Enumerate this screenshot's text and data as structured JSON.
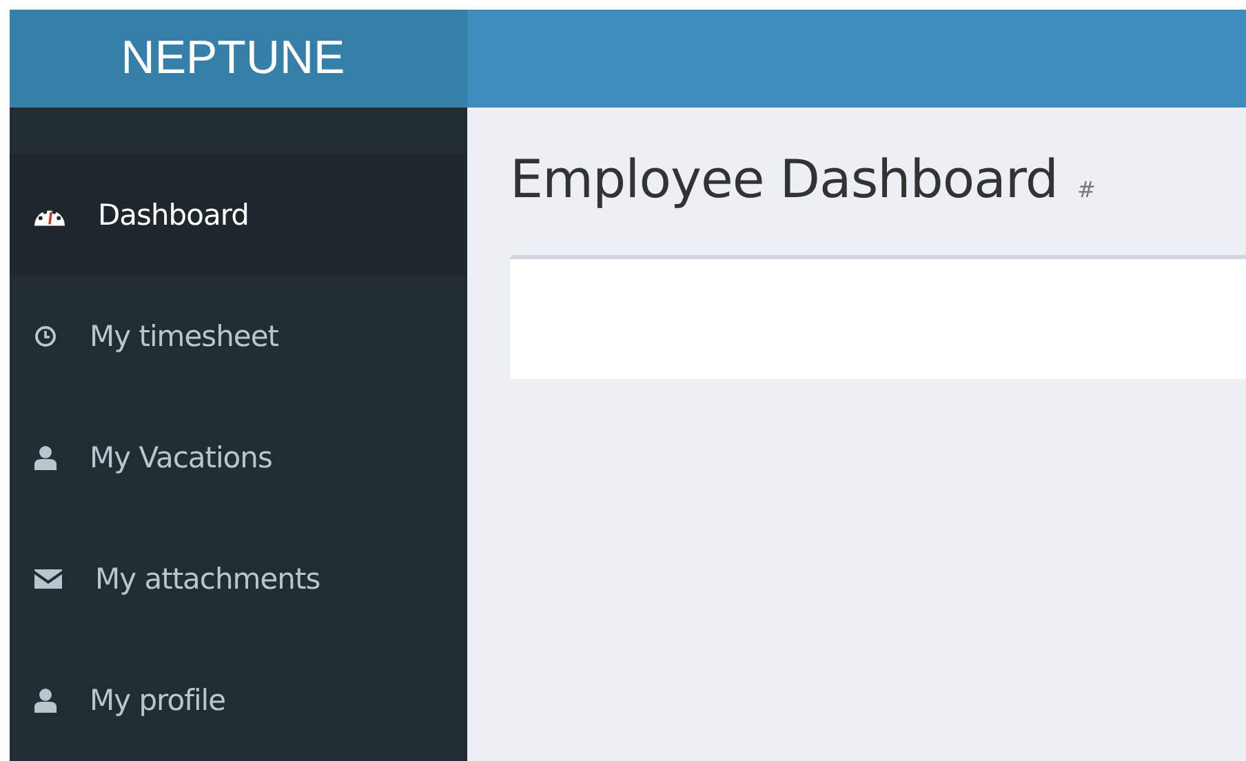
{
  "header": {
    "logo": "NEPTUNE"
  },
  "sidebar": {
    "items": [
      {
        "label": "Dashboard",
        "selected": true
      },
      {
        "label": "My timesheet",
        "selected": false
      },
      {
        "label": "My Vacations",
        "selected": false
      },
      {
        "label": "My attachments",
        "selected": false
      },
      {
        "label": "My profile",
        "selected": false
      }
    ]
  },
  "content": {
    "title": "Employee Dashboard",
    "title_link": "#"
  }
}
